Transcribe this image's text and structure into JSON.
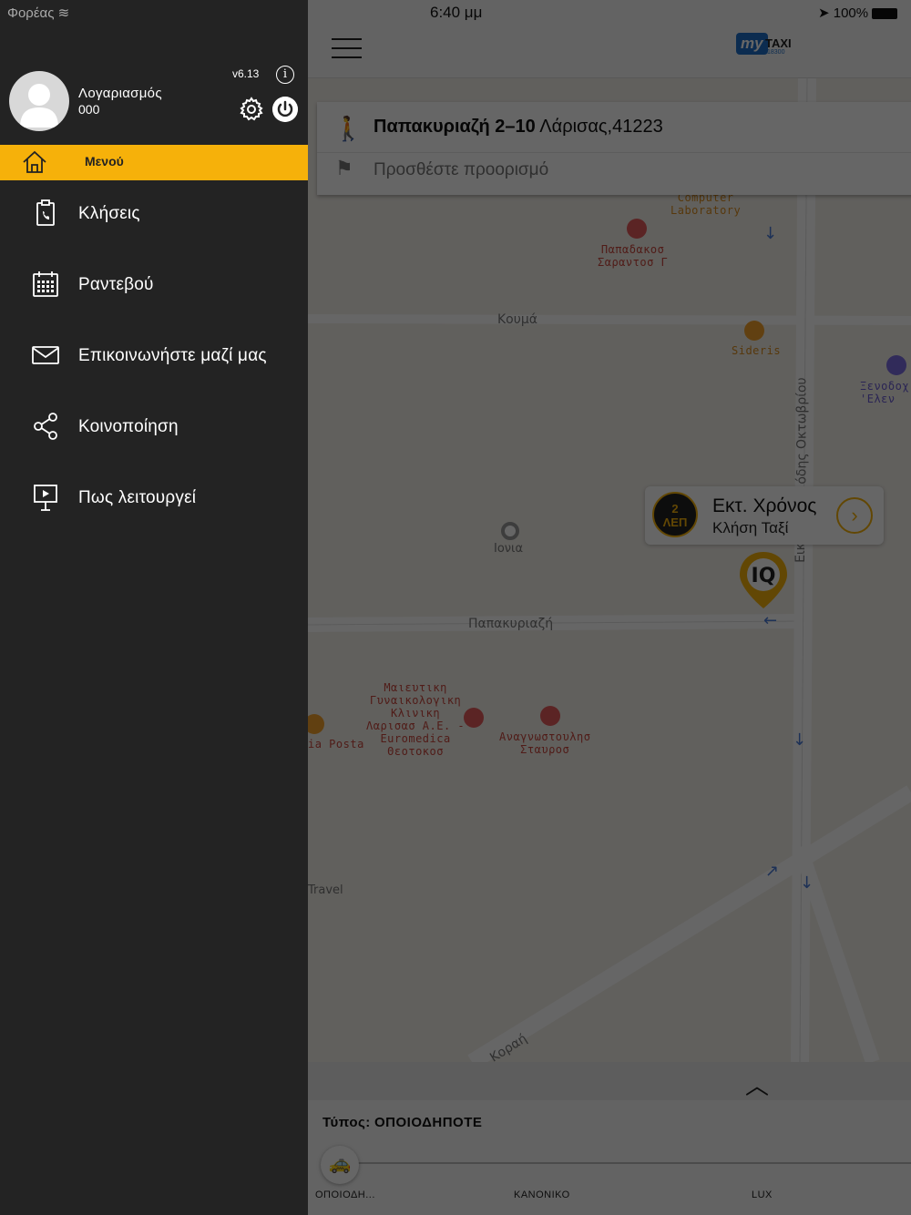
{
  "status_bar": {
    "carrier": "Φορέας",
    "time": "6:40 μμ",
    "battery": "100%"
  },
  "sidebar": {
    "account_label": "Λογαριασμός",
    "account_number": "000",
    "version": "v6.13",
    "menu_title": "Μενού",
    "items": [
      {
        "label": "Κλήσεις",
        "icon": "clipboard-call-icon"
      },
      {
        "label": "Ραντεβού",
        "icon": "calendar-icon"
      },
      {
        "label": "Επικοινωνήστε μαζί μας",
        "icon": "envelope-icon"
      },
      {
        "label": "Κοινοποίηση",
        "icon": "share-icon"
      },
      {
        "label": "Πως λειτουργεί",
        "icon": "presentation-icon"
      }
    ]
  },
  "app": {
    "logo_my": "my",
    "logo_taxi": "TAXI",
    "logo_number": "18300"
  },
  "pickup": {
    "street_bold": "Παπακυριαζή 2–10",
    "city": "Λάρισας,41223"
  },
  "destination": {
    "placeholder": "Προσθέστε προορισμό"
  },
  "eta": {
    "minutes": "2",
    "unit": "ΛΕΠ",
    "title": "Εκτ. Χρόνος",
    "subtitle": "Κλήση Ταξί"
  },
  "map": {
    "labels": [
      {
        "text": "ΜΗΔΕΝ ΕΝΑ\nComputer\nLaboratory",
        "color": "orange"
      },
      {
        "text": "Παπαδακοσ\nΣαραντοσ Γ",
        "color": "red"
      },
      {
        "text": "Κουμά",
        "color": "gray"
      },
      {
        "text": "Sideris",
        "color": "orange"
      },
      {
        "text": "Ξενοδοχ\n'Ελεν",
        "color": "purple"
      },
      {
        "text": "Ιονια",
        "color": "gray"
      },
      {
        "text": "Παπακυριαζή",
        "color": "gray"
      },
      {
        "text": "Μαιευτικη\nΓυναικολογικη\nΚλινικη\nΛαρισασ Α.Ε. -\nEuromedica\nΘεοτοκοσ",
        "color": "red"
      },
      {
        "text": "Αναγνωστουλησ\nΣταυροσ",
        "color": "red"
      },
      {
        "text": "ia Posta",
        "color": "red"
      },
      {
        "text": "Travel",
        "color": "gray"
      },
      {
        "text": "Κοραή",
        "color": "gray"
      },
      {
        "text": "όδης Οκτωβρίου",
        "color": "gray"
      },
      {
        "text": "Εικ",
        "color": "gray"
      }
    ]
  },
  "vehicle": {
    "type_label": "Τύπος:",
    "type_value": "ΟΠΟΙΟΔΗΠΟΤΕ",
    "options": [
      "ΟΠΟΙΟΔΗ...",
      "ΚΑΝΟΝΙΚΟ",
      "LUX"
    ]
  },
  "colors": {
    "accent": "#f6b10a",
    "sidebar_bg": "#232323"
  }
}
